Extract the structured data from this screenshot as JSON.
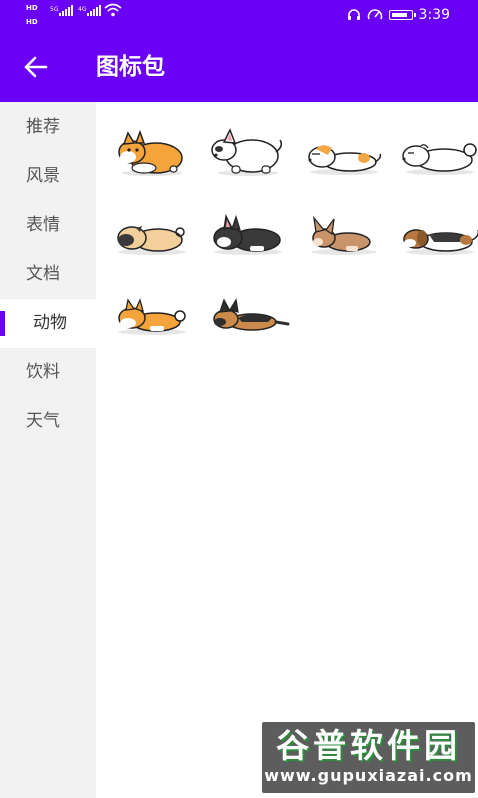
{
  "status_bar": {
    "time": "3:39",
    "hd_label_1": "HD",
    "hd_label_2": "HD",
    "network_1": "5G",
    "network_2": "4G",
    "battery_level": 0.9
  },
  "app_bar": {
    "title": "图标包"
  },
  "sidebar": {
    "items": [
      {
        "label": "推荐"
      },
      {
        "label": "风景"
      },
      {
        "label": "表情"
      },
      {
        "label": "文档"
      },
      {
        "label": "动物",
        "selected": true
      },
      {
        "label": "饮料"
      },
      {
        "label": "天气"
      }
    ]
  },
  "icon_grid": {
    "items": [
      {
        "icon": "corgi-sitting-icon",
        "color": "#f5a43c"
      },
      {
        "icon": "bull-terrier-sitting-icon",
        "color": "#ffffff"
      },
      {
        "icon": "jack-russell-lying-icon",
        "color": "#f2a646"
      },
      {
        "icon": "white-fluffy-dog-lying-icon",
        "color": "#ffffff"
      },
      {
        "icon": "pug-lying-icon",
        "color": "#f3cf9b"
      },
      {
        "icon": "boston-terrier-lying-icon",
        "color": "#3a3a3a"
      },
      {
        "icon": "chihuahua-lying-icon",
        "color": "#c9946a"
      },
      {
        "icon": "beagle-lying-icon",
        "color": "#b8783f"
      },
      {
        "icon": "shiba-lying-icon",
        "color": "#f5a43c"
      },
      {
        "icon": "german-shepherd-lying-icon",
        "color": "#8a5a2b"
      }
    ]
  },
  "watermark": {
    "name": "谷普软件园",
    "url": "www.gupuxiazai.com"
  },
  "colors": {
    "accent": "#6a00f4",
    "sidebar_bg": "#f2f2f2"
  }
}
